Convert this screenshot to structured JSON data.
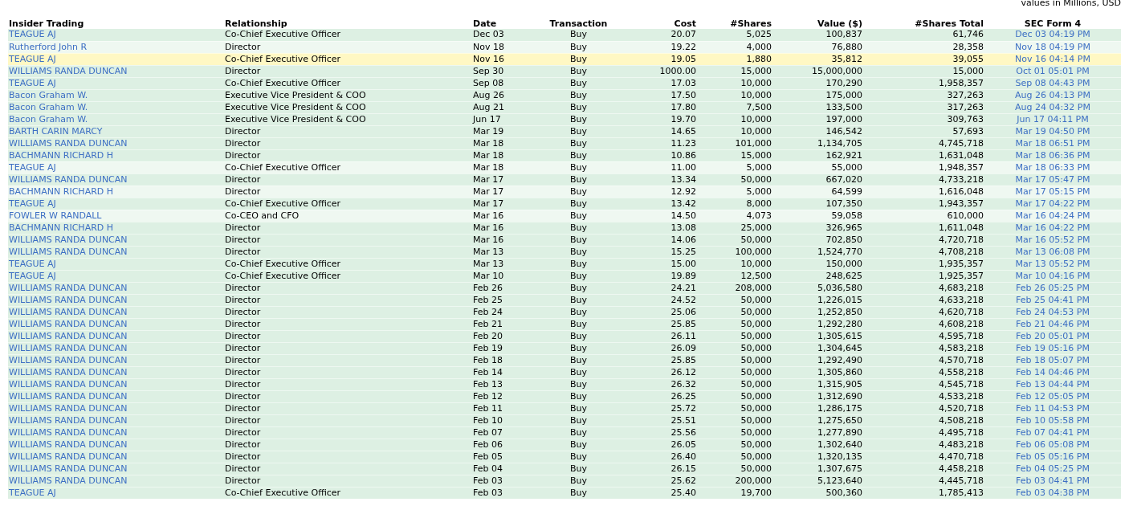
{
  "note": "values in Millions, USD",
  "table": {
    "columns": [
      "Insider Trading",
      "Relationship",
      "Date",
      "Transaction",
      "Cost",
      "#Shares",
      "Value ($)",
      "#Shares Total",
      "SEC Form 4"
    ],
    "rows": [
      {
        "insider": "TEAGUE AJ",
        "relationship": "Co-Chief Executive Officer",
        "date": "Dec 03",
        "transaction": "Buy",
        "cost": "20.07",
        "shares": "5,025",
        "value": "100,837",
        "shares_total": "61,746",
        "sec_form": "Dec 03 04:19 PM",
        "color": "#ddf0e3"
      },
      {
        "insider": "Rutherford John R",
        "relationship": "Director",
        "date": "Nov 18",
        "transaction": "Buy",
        "cost": "19.22",
        "shares": "4,000",
        "value": "76,880",
        "shares_total": "28,358",
        "sec_form": "Nov 18 04:19 PM",
        "color": "#eff8f1"
      },
      {
        "insider": "TEAGUE AJ",
        "relationship": "Co-Chief Executive Officer",
        "date": "Nov 16",
        "transaction": "Buy",
        "cost": "19.05",
        "shares": "1,880",
        "value": "35,812",
        "shares_total": "39,055",
        "sec_form": "Nov 16 04:14 PM",
        "color": "#fff8c4"
      },
      {
        "insider": "WILLIAMS RANDA DUNCAN",
        "relationship": "Director",
        "date": "Sep 30",
        "transaction": "Buy",
        "cost": "1000.00",
        "shares": "15,000",
        "value": "15,000,000",
        "shares_total": "15,000",
        "sec_form": "Oct 01 05:01 PM",
        "color": "#ddf0e3"
      },
      {
        "insider": "TEAGUE AJ",
        "relationship": "Co-Chief Executive Officer",
        "date": "Sep 08",
        "transaction": "Buy",
        "cost": "17.03",
        "shares": "10,000",
        "value": "170,290",
        "shares_total": "1,958,357",
        "sec_form": "Sep 08 04:43 PM",
        "color": "#ddf0e3"
      },
      {
        "insider": "Bacon Graham W.",
        "relationship": "Executive Vice President & COO",
        "date": "Aug 26",
        "transaction": "Buy",
        "cost": "17.50",
        "shares": "10,000",
        "value": "175,000",
        "shares_total": "327,263",
        "sec_form": "Aug 26 04:13 PM",
        "color": "#ddf0e3"
      },
      {
        "insider": "Bacon Graham W.",
        "relationship": "Executive Vice President & COO",
        "date": "Aug 21",
        "transaction": "Buy",
        "cost": "17.80",
        "shares": "7,500",
        "value": "133,500",
        "shares_total": "317,263",
        "sec_form": "Aug 24 04:32 PM",
        "color": "#ddf0e3"
      },
      {
        "insider": "Bacon Graham W.",
        "relationship": "Executive Vice President & COO",
        "date": "Jun 17",
        "transaction": "Buy",
        "cost": "19.70",
        "shares": "10,000",
        "value": "197,000",
        "shares_total": "309,763",
        "sec_form": "Jun 17 04:11 PM",
        "color": "#ddf0e3"
      },
      {
        "insider": "BARTH CARIN MARCY",
        "relationship": "Director",
        "date": "Mar 19",
        "transaction": "Buy",
        "cost": "14.65",
        "shares": "10,000",
        "value": "146,542",
        "shares_total": "57,693",
        "sec_form": "Mar 19 04:50 PM",
        "color": "#ddf0e3"
      },
      {
        "insider": "WILLIAMS RANDA DUNCAN",
        "relationship": "Director",
        "date": "Mar 18",
        "transaction": "Buy",
        "cost": "11.23",
        "shares": "101,000",
        "value": "1,134,705",
        "shares_total": "4,745,718",
        "sec_form": "Mar 18 06:51 PM",
        "color": "#ddf0e3"
      },
      {
        "insider": "BACHMANN RICHARD H",
        "relationship": "Director",
        "date": "Mar 18",
        "transaction": "Buy",
        "cost": "10.86",
        "shares": "15,000",
        "value": "162,921",
        "shares_total": "1,631,048",
        "sec_form": "Mar 18 06:36 PM",
        "color": "#ddf0e3"
      },
      {
        "insider": "TEAGUE AJ",
        "relationship": "Co-Chief Executive Officer",
        "date": "Mar 18",
        "transaction": "Buy",
        "cost": "11.00",
        "shares": "5,000",
        "value": "55,000",
        "shares_total": "1,948,357",
        "sec_form": "Mar 18 06:33 PM",
        "color": "#eff8f1"
      },
      {
        "insider": "WILLIAMS RANDA DUNCAN",
        "relationship": "Director",
        "date": "Mar 17",
        "transaction": "Buy",
        "cost": "13.34",
        "shares": "50,000",
        "value": "667,020",
        "shares_total": "4,733,218",
        "sec_form": "Mar 17 05:47 PM",
        "color": "#ddf0e3"
      },
      {
        "insider": "BACHMANN RICHARD H",
        "relationship": "Director",
        "date": "Mar 17",
        "transaction": "Buy",
        "cost": "12.92",
        "shares": "5,000",
        "value": "64,599",
        "shares_total": "1,616,048",
        "sec_form": "Mar 17 05:15 PM",
        "color": "#eff8f1"
      },
      {
        "insider": "TEAGUE AJ",
        "relationship": "Co-Chief Executive Officer",
        "date": "Mar 17",
        "transaction": "Buy",
        "cost": "13.42",
        "shares": "8,000",
        "value": "107,350",
        "shares_total": "1,943,357",
        "sec_form": "Mar 17 04:22 PM",
        "color": "#ddf0e3"
      },
      {
        "insider": "FOWLER W RANDALL",
        "relationship": "Co-CEO and CFO",
        "date": "Mar 16",
        "transaction": "Buy",
        "cost": "14.50",
        "shares": "4,073",
        "value": "59,058",
        "shares_total": "610,000",
        "sec_form": "Mar 16 04:24 PM",
        "color": "#eff8f1"
      },
      {
        "insider": "BACHMANN RICHARD H",
        "relationship": "Director",
        "date": "Mar 16",
        "transaction": "Buy",
        "cost": "13.08",
        "shares": "25,000",
        "value": "326,965",
        "shares_total": "1,611,048",
        "sec_form": "Mar 16 04:22 PM",
        "color": "#ddf0e3"
      },
      {
        "insider": "WILLIAMS RANDA DUNCAN",
        "relationship": "Director",
        "date": "Mar 16",
        "transaction": "Buy",
        "cost": "14.06",
        "shares": "50,000",
        "value": "702,850",
        "shares_total": "4,720,718",
        "sec_form": "Mar 16 05:52 PM",
        "color": "#ddf0e3"
      },
      {
        "insider": "WILLIAMS RANDA DUNCAN",
        "relationship": "Director",
        "date": "Mar 13",
        "transaction": "Buy",
        "cost": "15.25",
        "shares": "100,000",
        "value": "1,524,770",
        "shares_total": "4,708,218",
        "sec_form": "Mar 13 06:08 PM",
        "color": "#ddf0e3"
      },
      {
        "insider": "TEAGUE AJ",
        "relationship": "Co-Chief Executive Officer",
        "date": "Mar 13",
        "transaction": "Buy",
        "cost": "15.00",
        "shares": "10,000",
        "value": "150,000",
        "shares_total": "1,935,357",
        "sec_form": "Mar 13 05:52 PM",
        "color": "#ddf0e3"
      },
      {
        "insider": "TEAGUE AJ",
        "relationship": "Co-Chief Executive Officer",
        "date": "Mar 10",
        "transaction": "Buy",
        "cost": "19.89",
        "shares": "12,500",
        "value": "248,625",
        "shares_total": "1,925,357",
        "sec_form": "Mar 10 04:16 PM",
        "color": "#ddf0e3"
      },
      {
        "insider": "WILLIAMS RANDA DUNCAN",
        "relationship": "Director",
        "date": "Feb 26",
        "transaction": "Buy",
        "cost": "24.21",
        "shares": "208,000",
        "value": "5,036,580",
        "shares_total": "4,683,218",
        "sec_form": "Feb 26 05:25 PM",
        "color": "#ddf0e3"
      },
      {
        "insider": "WILLIAMS RANDA DUNCAN",
        "relationship": "Director",
        "date": "Feb 25",
        "transaction": "Buy",
        "cost": "24.52",
        "shares": "50,000",
        "value": "1,226,015",
        "shares_total": "4,633,218",
        "sec_form": "Feb 25 04:41 PM",
        "color": "#ddf0e3"
      },
      {
        "insider": "WILLIAMS RANDA DUNCAN",
        "relationship": "Director",
        "date": "Feb 24",
        "transaction": "Buy",
        "cost": "25.06",
        "shares": "50,000",
        "value": "1,252,850",
        "shares_total": "4,620,718",
        "sec_form": "Feb 24 04:53 PM",
        "color": "#ddf0e3"
      },
      {
        "insider": "WILLIAMS RANDA DUNCAN",
        "relationship": "Director",
        "date": "Feb 21",
        "transaction": "Buy",
        "cost": "25.85",
        "shares": "50,000",
        "value": "1,292,280",
        "shares_total": "4,608,218",
        "sec_form": "Feb 21 04:46 PM",
        "color": "#ddf0e3"
      },
      {
        "insider": "WILLIAMS RANDA DUNCAN",
        "relationship": "Director",
        "date": "Feb 20",
        "transaction": "Buy",
        "cost": "26.11",
        "shares": "50,000",
        "value": "1,305,615",
        "shares_total": "4,595,718",
        "sec_form": "Feb 20 05:01 PM",
        "color": "#ddf0e3"
      },
      {
        "insider": "WILLIAMS RANDA DUNCAN",
        "relationship": "Director",
        "date": "Feb 19",
        "transaction": "Buy",
        "cost": "26.09",
        "shares": "50,000",
        "value": "1,304,645",
        "shares_total": "4,583,218",
        "sec_form": "Feb 19 05:16 PM",
        "color": "#ddf0e3"
      },
      {
        "insider": "WILLIAMS RANDA DUNCAN",
        "relationship": "Director",
        "date": "Feb 18",
        "transaction": "Buy",
        "cost": "25.85",
        "shares": "50,000",
        "value": "1,292,490",
        "shares_total": "4,570,718",
        "sec_form": "Feb 18 05:07 PM",
        "color": "#ddf0e3"
      },
      {
        "insider": "WILLIAMS RANDA DUNCAN",
        "relationship": "Director",
        "date": "Feb 14",
        "transaction": "Buy",
        "cost": "26.12",
        "shares": "50,000",
        "value": "1,305,860",
        "shares_total": "4,558,218",
        "sec_form": "Feb 14 04:46 PM",
        "color": "#ddf0e3"
      },
      {
        "insider": "WILLIAMS RANDA DUNCAN",
        "relationship": "Director",
        "date": "Feb 13",
        "transaction": "Buy",
        "cost": "26.32",
        "shares": "50,000",
        "value": "1,315,905",
        "shares_total": "4,545,718",
        "sec_form": "Feb 13 04:44 PM",
        "color": "#ddf0e3"
      },
      {
        "insider": "WILLIAMS RANDA DUNCAN",
        "relationship": "Director",
        "date": "Feb 12",
        "transaction": "Buy",
        "cost": "26.25",
        "shares": "50,000",
        "value": "1,312,690",
        "shares_total": "4,533,218",
        "sec_form": "Feb 12 05:05 PM",
        "color": "#ddf0e3"
      },
      {
        "insider": "WILLIAMS RANDA DUNCAN",
        "relationship": "Director",
        "date": "Feb 11",
        "transaction": "Buy",
        "cost": "25.72",
        "shares": "50,000",
        "value": "1,286,175",
        "shares_total": "4,520,718",
        "sec_form": "Feb 11 04:53 PM",
        "color": "#ddf0e3"
      },
      {
        "insider": "WILLIAMS RANDA DUNCAN",
        "relationship": "Director",
        "date": "Feb 10",
        "transaction": "Buy",
        "cost": "25.51",
        "shares": "50,000",
        "value": "1,275,650",
        "shares_total": "4,508,218",
        "sec_form": "Feb 10 05:58 PM",
        "color": "#ddf0e3"
      },
      {
        "insider": "WILLIAMS RANDA DUNCAN",
        "relationship": "Director",
        "date": "Feb 07",
        "transaction": "Buy",
        "cost": "25.56",
        "shares": "50,000",
        "value": "1,277,890",
        "shares_total": "4,495,718",
        "sec_form": "Feb 07 04:41 PM",
        "color": "#ddf0e3"
      },
      {
        "insider": "WILLIAMS RANDA DUNCAN",
        "relationship": "Director",
        "date": "Feb 06",
        "transaction": "Buy",
        "cost": "26.05",
        "shares": "50,000",
        "value": "1,302,640",
        "shares_total": "4,483,218",
        "sec_form": "Feb 06 05:08 PM",
        "color": "#ddf0e3"
      },
      {
        "insider": "WILLIAMS RANDA DUNCAN",
        "relationship": "Director",
        "date": "Feb 05",
        "transaction": "Buy",
        "cost": "26.40",
        "shares": "50,000",
        "value": "1,320,135",
        "shares_total": "4,470,718",
        "sec_form": "Feb 05 05:16 PM",
        "color": "#ddf0e3"
      },
      {
        "insider": "WILLIAMS RANDA DUNCAN",
        "relationship": "Director",
        "date": "Feb 04",
        "transaction": "Buy",
        "cost": "26.15",
        "shares": "50,000",
        "value": "1,307,675",
        "shares_total": "4,458,218",
        "sec_form": "Feb 04 05:25 PM",
        "color": "#ddf0e3"
      },
      {
        "insider": "WILLIAMS RANDA DUNCAN",
        "relationship": "Director",
        "date": "Feb 03",
        "transaction": "Buy",
        "cost": "25.62",
        "shares": "200,000",
        "value": "5,123,640",
        "shares_total": "4,445,718",
        "sec_form": "Feb 03 04:41 PM",
        "color": "#ddf0e3"
      },
      {
        "insider": "TEAGUE AJ",
        "relationship": "Co-Chief Executive Officer",
        "date": "Feb 03",
        "transaction": "Buy",
        "cost": "25.40",
        "shares": "19,700",
        "value": "500,360",
        "shares_total": "1,785,413",
        "sec_form": "Feb 03 04:38 PM",
        "color": "#ddf0e3"
      }
    ]
  }
}
